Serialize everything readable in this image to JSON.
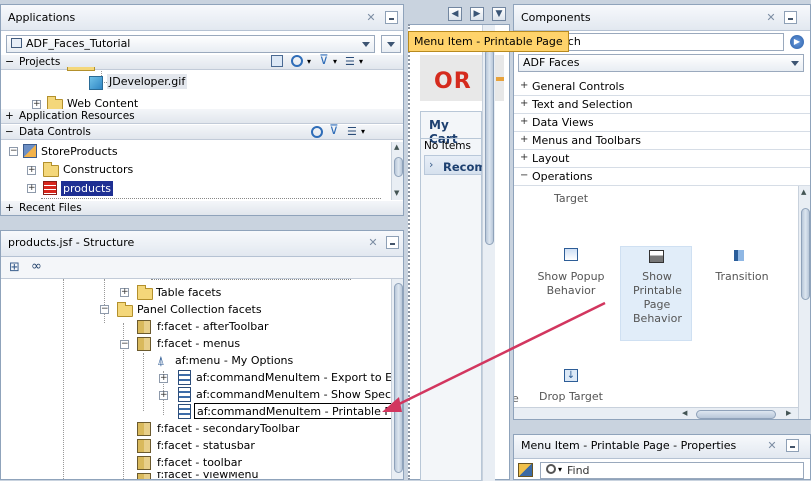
{
  "applications": {
    "title": "Applications",
    "app_name": "ADF_Faces_Tutorial",
    "projects_label": "Projects",
    "tree": [
      {
        "label": "JDeveloper.gif"
      },
      {
        "label": "Web Content"
      }
    ],
    "app_resources_label": "Application Resources",
    "data_controls_label": "Data Controls",
    "data_tree": [
      {
        "label": "StoreProducts"
      },
      {
        "label": "Constructors"
      },
      {
        "label": "products"
      }
    ],
    "recent_files_label": "Recent Files"
  },
  "structure": {
    "title": "products.jsf - Structure",
    "tree": [
      {
        "label": "Table facets"
      },
      {
        "label": "Panel Collection facets"
      },
      {
        "label": "f:facet - afterToolbar"
      },
      {
        "label": "f:facet - menus"
      },
      {
        "label": "af:menu - My Options"
      },
      {
        "label": "af:commandMenuItem - Export to Excel"
      },
      {
        "label": "af:commandMenuItem - Show Specials"
      },
      {
        "label": "af:commandMenuItem - Printable Page"
      },
      {
        "label": "f:facet - secondaryToolbar"
      },
      {
        "label": "f:facet - statusbar"
      },
      {
        "label": "f:facet - toolbar"
      },
      {
        "label": "f:facet - viewMenu"
      }
    ]
  },
  "editor": {
    "logo_text": "OR",
    "cart_title": "My Cart",
    "no_items": "No Items",
    "recommend": "Recom"
  },
  "tooltip": {
    "text": "Menu Item - Printable Page"
  },
  "components": {
    "title": "Components",
    "search_placeholder": "Search",
    "library": "ADF Faces",
    "categories": [
      {
        "label": "General Controls"
      },
      {
        "label": "Text and Selection"
      },
      {
        "label": "Data Views"
      },
      {
        "label": "Menus and Toolbars"
      },
      {
        "label": "Layout"
      },
      {
        "label": "Operations"
      }
    ],
    "items": {
      "target": "Target",
      "show_popup": "Show Popup Behavior",
      "show_printable": "Show Printable Page Behavior",
      "transition": "Transition",
      "drop_target": "Drop Target"
    }
  },
  "properties": {
    "title": "Menu Item - Printable Page - Properties",
    "find_placeholder": "Find"
  },
  "colors": {
    "accent_arrow": "#d2365f",
    "selected_bg": "#1e2f93",
    "tooltip_bg": "#ffd36b"
  }
}
